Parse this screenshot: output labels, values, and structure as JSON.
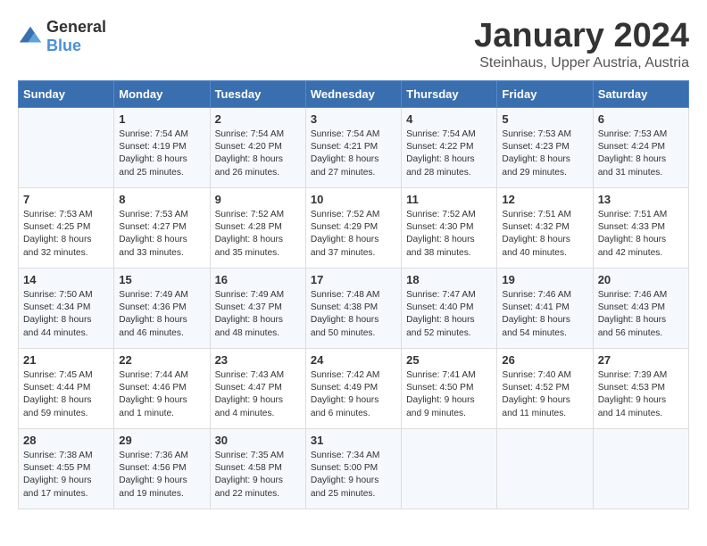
{
  "header": {
    "logo_general": "General",
    "logo_blue": "Blue",
    "title": "January 2024",
    "subtitle": "Steinhaus, Upper Austria, Austria"
  },
  "weekdays": [
    "Sunday",
    "Monday",
    "Tuesday",
    "Wednesday",
    "Thursday",
    "Friday",
    "Saturday"
  ],
  "weeks": [
    [
      {
        "day": "",
        "content": ""
      },
      {
        "day": "1",
        "content": "Sunrise: 7:54 AM\nSunset: 4:19 PM\nDaylight: 8 hours\nand 25 minutes."
      },
      {
        "day": "2",
        "content": "Sunrise: 7:54 AM\nSunset: 4:20 PM\nDaylight: 8 hours\nand 26 minutes."
      },
      {
        "day": "3",
        "content": "Sunrise: 7:54 AM\nSunset: 4:21 PM\nDaylight: 8 hours\nand 27 minutes."
      },
      {
        "day": "4",
        "content": "Sunrise: 7:54 AM\nSunset: 4:22 PM\nDaylight: 8 hours\nand 28 minutes."
      },
      {
        "day": "5",
        "content": "Sunrise: 7:53 AM\nSunset: 4:23 PM\nDaylight: 8 hours\nand 29 minutes."
      },
      {
        "day": "6",
        "content": "Sunrise: 7:53 AM\nSunset: 4:24 PM\nDaylight: 8 hours\nand 31 minutes."
      }
    ],
    [
      {
        "day": "7",
        "content": "Sunrise: 7:53 AM\nSunset: 4:25 PM\nDaylight: 8 hours\nand 32 minutes."
      },
      {
        "day": "8",
        "content": "Sunrise: 7:53 AM\nSunset: 4:27 PM\nDaylight: 8 hours\nand 33 minutes."
      },
      {
        "day": "9",
        "content": "Sunrise: 7:52 AM\nSunset: 4:28 PM\nDaylight: 8 hours\nand 35 minutes."
      },
      {
        "day": "10",
        "content": "Sunrise: 7:52 AM\nSunset: 4:29 PM\nDaylight: 8 hours\nand 37 minutes."
      },
      {
        "day": "11",
        "content": "Sunrise: 7:52 AM\nSunset: 4:30 PM\nDaylight: 8 hours\nand 38 minutes."
      },
      {
        "day": "12",
        "content": "Sunrise: 7:51 AM\nSunset: 4:32 PM\nDaylight: 8 hours\nand 40 minutes."
      },
      {
        "day": "13",
        "content": "Sunrise: 7:51 AM\nSunset: 4:33 PM\nDaylight: 8 hours\nand 42 minutes."
      }
    ],
    [
      {
        "day": "14",
        "content": "Sunrise: 7:50 AM\nSunset: 4:34 PM\nDaylight: 8 hours\nand 44 minutes."
      },
      {
        "day": "15",
        "content": "Sunrise: 7:49 AM\nSunset: 4:36 PM\nDaylight: 8 hours\nand 46 minutes."
      },
      {
        "day": "16",
        "content": "Sunrise: 7:49 AM\nSunset: 4:37 PM\nDaylight: 8 hours\nand 48 minutes."
      },
      {
        "day": "17",
        "content": "Sunrise: 7:48 AM\nSunset: 4:38 PM\nDaylight: 8 hours\nand 50 minutes."
      },
      {
        "day": "18",
        "content": "Sunrise: 7:47 AM\nSunset: 4:40 PM\nDaylight: 8 hours\nand 52 minutes."
      },
      {
        "day": "19",
        "content": "Sunrise: 7:46 AM\nSunset: 4:41 PM\nDaylight: 8 hours\nand 54 minutes."
      },
      {
        "day": "20",
        "content": "Sunrise: 7:46 AM\nSunset: 4:43 PM\nDaylight: 8 hours\nand 56 minutes."
      }
    ],
    [
      {
        "day": "21",
        "content": "Sunrise: 7:45 AM\nSunset: 4:44 PM\nDaylight: 8 hours\nand 59 minutes."
      },
      {
        "day": "22",
        "content": "Sunrise: 7:44 AM\nSunset: 4:46 PM\nDaylight: 9 hours\nand 1 minute."
      },
      {
        "day": "23",
        "content": "Sunrise: 7:43 AM\nSunset: 4:47 PM\nDaylight: 9 hours\nand 4 minutes."
      },
      {
        "day": "24",
        "content": "Sunrise: 7:42 AM\nSunset: 4:49 PM\nDaylight: 9 hours\nand 6 minutes."
      },
      {
        "day": "25",
        "content": "Sunrise: 7:41 AM\nSunset: 4:50 PM\nDaylight: 9 hours\nand 9 minutes."
      },
      {
        "day": "26",
        "content": "Sunrise: 7:40 AM\nSunset: 4:52 PM\nDaylight: 9 hours\nand 11 minutes."
      },
      {
        "day": "27",
        "content": "Sunrise: 7:39 AM\nSunset: 4:53 PM\nDaylight: 9 hours\nand 14 minutes."
      }
    ],
    [
      {
        "day": "28",
        "content": "Sunrise: 7:38 AM\nSunset: 4:55 PM\nDaylight: 9 hours\nand 17 minutes."
      },
      {
        "day": "29",
        "content": "Sunrise: 7:36 AM\nSunset: 4:56 PM\nDaylight: 9 hours\nand 19 minutes."
      },
      {
        "day": "30",
        "content": "Sunrise: 7:35 AM\nSunset: 4:58 PM\nDaylight: 9 hours\nand 22 minutes."
      },
      {
        "day": "31",
        "content": "Sunrise: 7:34 AM\nSunset: 5:00 PM\nDaylight: 9 hours\nand 25 minutes."
      },
      {
        "day": "",
        "content": ""
      },
      {
        "day": "",
        "content": ""
      },
      {
        "day": "",
        "content": ""
      }
    ]
  ]
}
